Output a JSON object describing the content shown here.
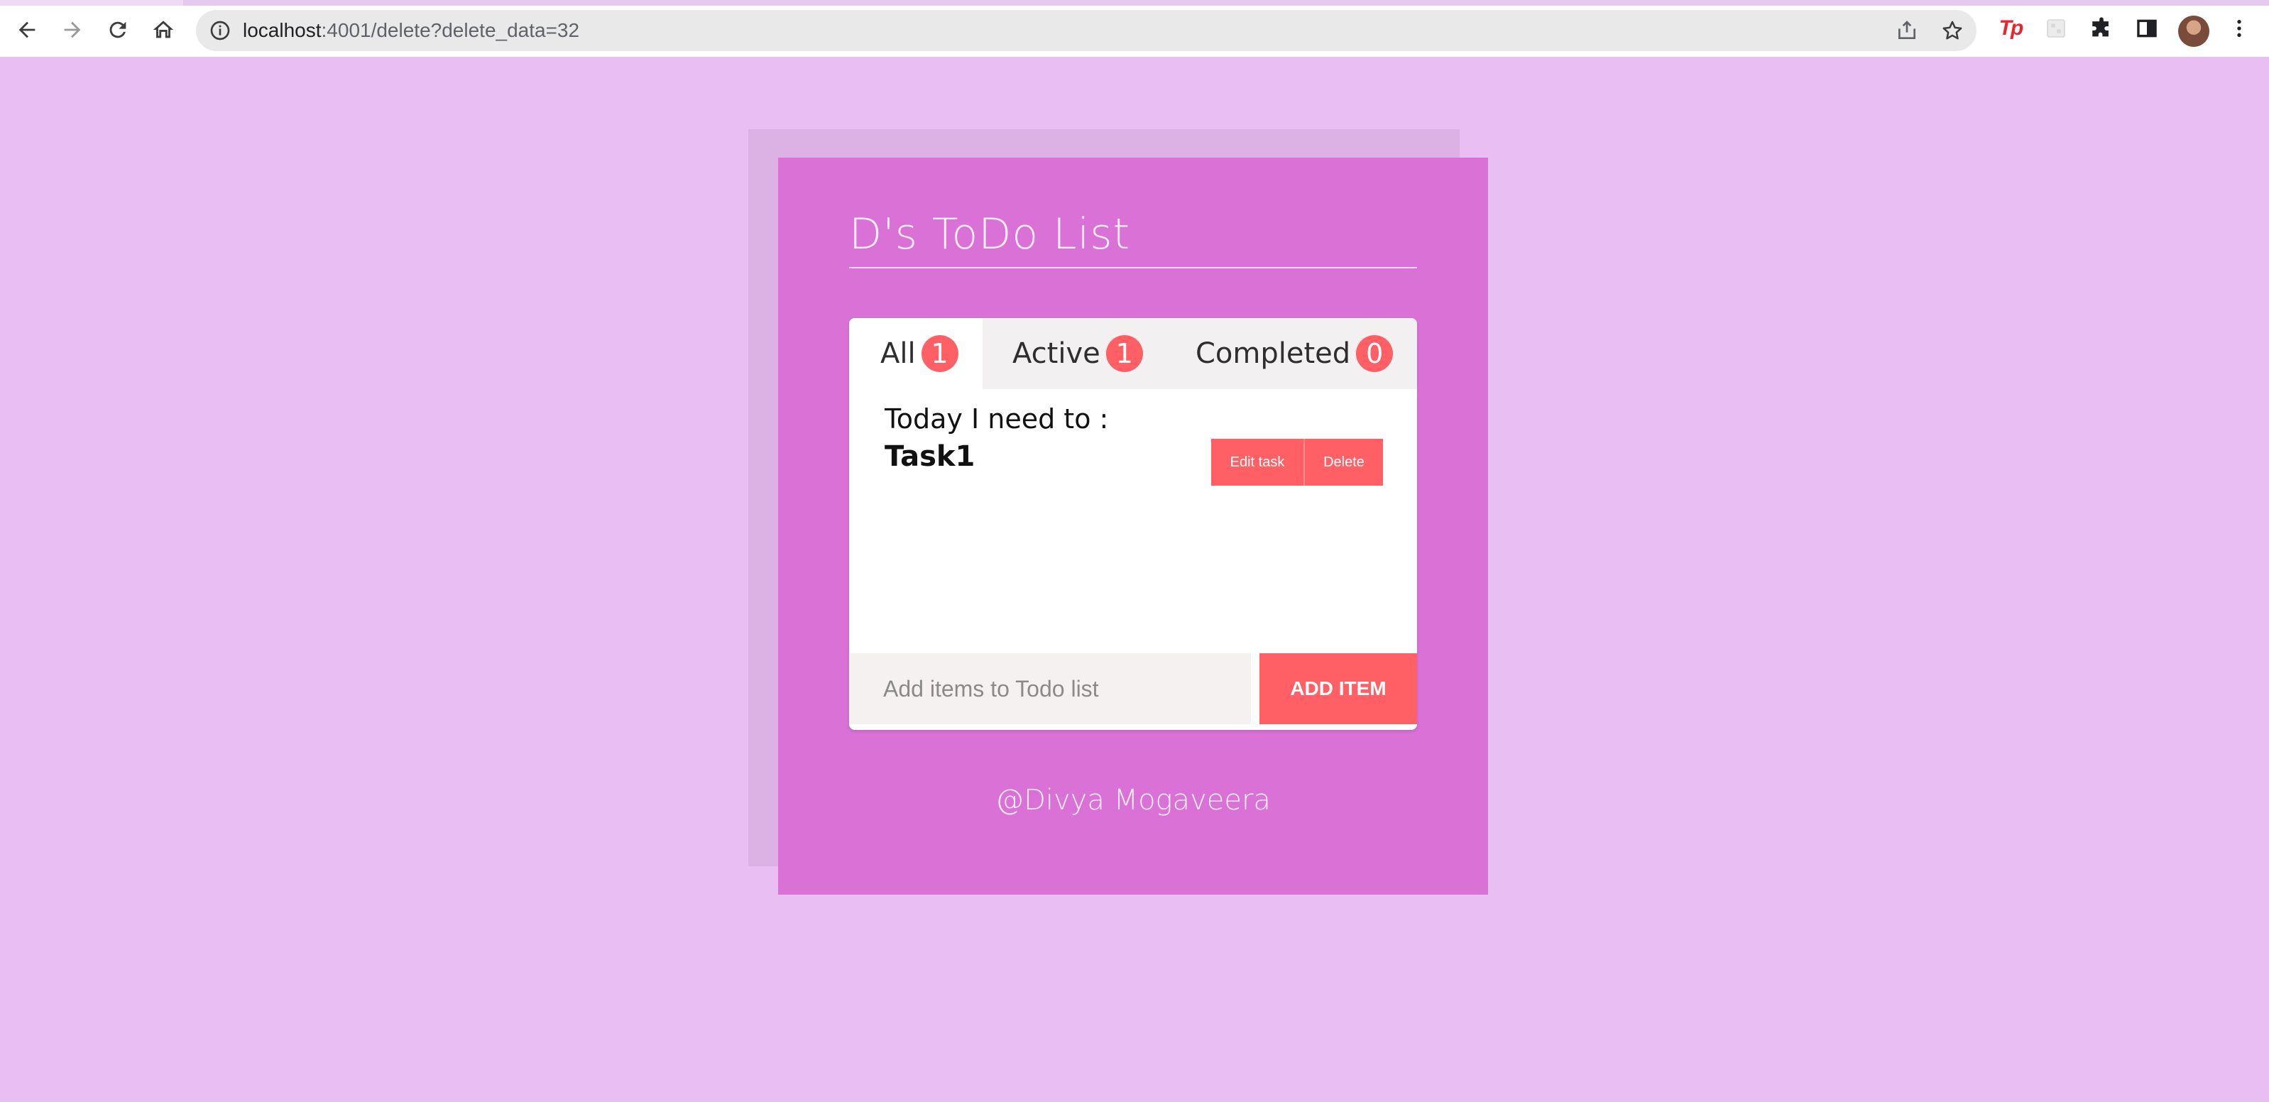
{
  "browser": {
    "url_host": "localhost",
    "url_rest": ":4001/delete?delete_data=32",
    "icons": [
      "back-arrow-icon",
      "forward-arrow-icon",
      "reload-icon",
      "home-icon",
      "info-icon",
      "share-icon",
      "star-icon",
      "tp-extension-icon",
      "extension-tile-icon",
      "puzzle-icon",
      "side-panel-icon",
      "avatar",
      "menu-dots-icon"
    ],
    "tp_label": "Tp"
  },
  "app": {
    "title": "D's ToDo List",
    "tabs": [
      {
        "label": "All",
        "count": "1"
      },
      {
        "label": "Active",
        "count": "1"
      },
      {
        "label": "Completed",
        "count": "0"
      }
    ],
    "task_heading": "Today I need to :",
    "task": {
      "name": "Task1",
      "edit_label": "Edit task",
      "delete_label": "Delete"
    },
    "add": {
      "placeholder": "Add items to Todo list",
      "button_label": "ADD ITEM"
    },
    "footer": "@Divya Mogaveera"
  },
  "colors": {
    "page_bg": "#e9bff3",
    "card_bg": "#d971d6",
    "accent": "#ff6066"
  }
}
